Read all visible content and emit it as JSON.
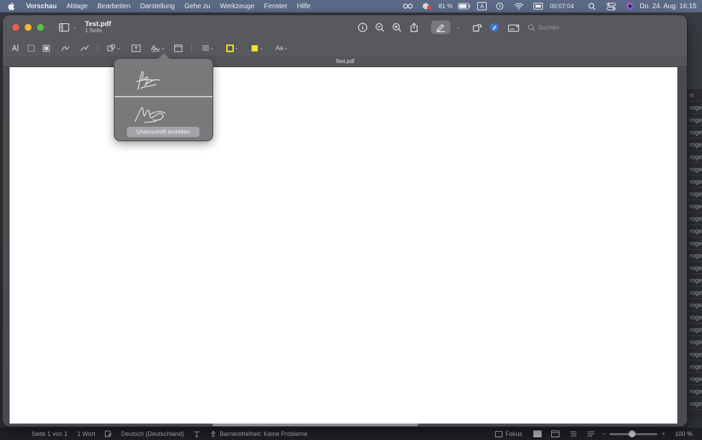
{
  "menubar": {
    "app_name": "Vorschau",
    "items": [
      "Ablage",
      "Bearbeiten",
      "Darstellung",
      "Gehe zu",
      "Werkzeuge",
      "Fenster",
      "Hilfe"
    ],
    "battery": "81 %",
    "keyboard_indicator": "A",
    "timer": "00:07:04",
    "clock": "Do. 24. Aug.  16:15"
  },
  "window": {
    "title": "Test.pdf",
    "subtitle": "1 Seite",
    "filename_bar": "Test.pdf",
    "search_placeholder": "Suchen"
  },
  "markup_toolbar": {
    "font_button": "Aa"
  },
  "popover": {
    "create_button": "Unterschrift erstellen"
  },
  "background_doc": {
    "fragments": [
      "rt",
      "roge",
      "roge",
      "roge",
      "roge",
      "roge",
      "roge",
      "roge",
      "roge",
      "roge",
      "roge",
      "roge",
      "roge",
      "roge",
      "roge",
      "roge",
      "roge",
      "roge",
      "roge",
      "roge",
      "roge",
      "roge",
      "roge",
      "roge",
      "roge",
      "roge"
    ]
  },
  "word_statusbar": {
    "page": "Seite 1 von 1",
    "words": "1 Wort",
    "language": "Deutsch (Deutschland)",
    "accessibility": "Barrierefreiheit: Keine Probleme",
    "focus": "Fokus",
    "zoom": "100 %"
  },
  "colors": {
    "menubar": "#5b6a86",
    "window_chrome": "#58595d",
    "popover": "#79797c",
    "close": "#ee5d55",
    "minimize": "#f3b93a",
    "zoom": "#57c242",
    "page": "#ffffff"
  }
}
